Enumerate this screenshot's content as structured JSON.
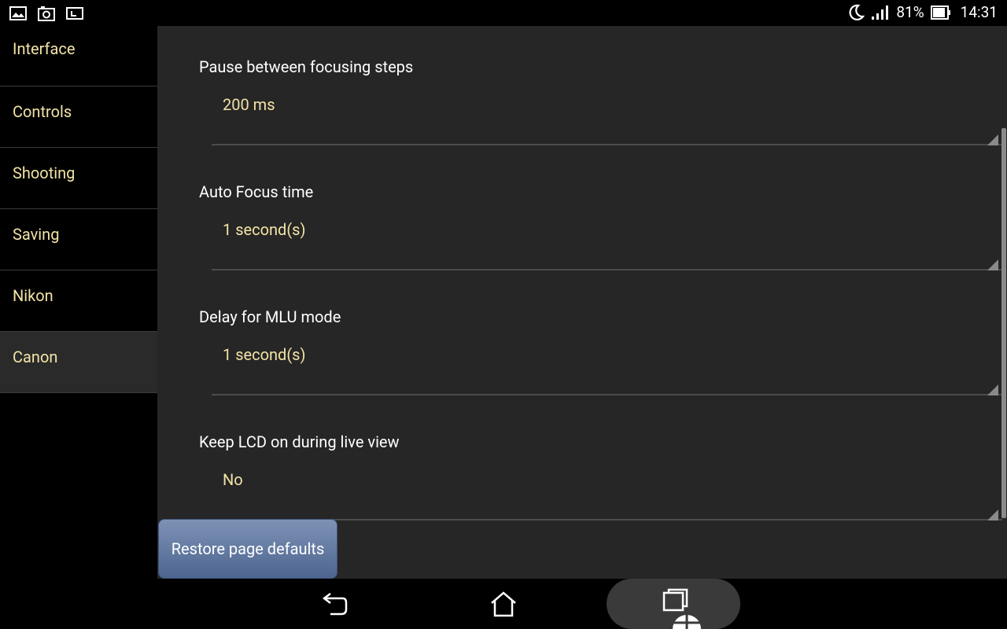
{
  "status_bar": {
    "battery": "81%",
    "time": "14:31"
  },
  "sidebar": {
    "items": [
      {
        "label": "Interface"
      },
      {
        "label": "Controls"
      },
      {
        "label": "Shooting"
      },
      {
        "label": "Saving"
      },
      {
        "label": "Nikon"
      },
      {
        "label": "Canon"
      }
    ],
    "selected": "Canon"
  },
  "preferences": [
    {
      "title": "Pause between focusing steps",
      "value": "200 ms"
    },
    {
      "title": "Auto Focus time",
      "value": "1  second(s)"
    },
    {
      "title": "Delay for MLU mode",
      "value": "1  second(s)"
    },
    {
      "title": "Keep LCD on during live view",
      "value": "No"
    }
  ],
  "restore_button": {
    "label": "Restore page defaults"
  },
  "colors": {
    "value_text": "#f2e3a6",
    "panel_bg": "#262626",
    "button_blue": "#5a719a"
  }
}
